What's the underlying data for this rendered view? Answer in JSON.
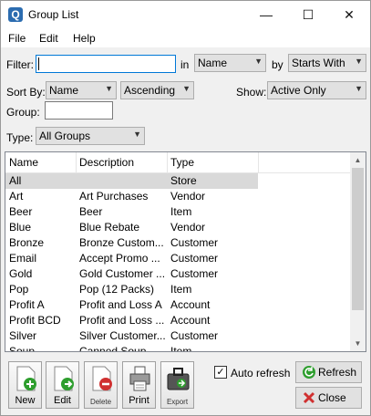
{
  "window": {
    "title": "Group List",
    "app_icon": "Q"
  },
  "menu": [
    "File",
    "Edit",
    "Help"
  ],
  "filter": {
    "label": "Filter:",
    "value": "",
    "in_label": "in",
    "in_value": "Name",
    "by_label": "by",
    "by_value": "Starts With"
  },
  "sort": {
    "label": "Sort By:",
    "field": "Name",
    "order": "Ascending"
  },
  "show": {
    "label": "Show:",
    "value": "Active Only"
  },
  "group": {
    "label": "Group:",
    "value": ""
  },
  "type": {
    "label": "Type:",
    "value": "All Groups"
  },
  "list": {
    "columns": [
      "Name",
      "Description",
      "Type"
    ],
    "rows": [
      {
        "name": "All",
        "description": "",
        "type": "Store"
      },
      {
        "name": "Art",
        "description": "Art Purchases",
        "type": "Vendor"
      },
      {
        "name": "Beer",
        "description": "Beer",
        "type": "Item"
      },
      {
        "name": "Blue",
        "description": "Blue Rebate",
        "type": "Vendor"
      },
      {
        "name": "Bronze",
        "description": "Bronze Custom...",
        "type": "Customer"
      },
      {
        "name": "Email",
        "description": "Accept Promo ...",
        "type": "Customer"
      },
      {
        "name": "Gold",
        "description": "Gold Customer ...",
        "type": "Customer"
      },
      {
        "name": "Pop",
        "description": "Pop (12 Packs)",
        "type": "Item"
      },
      {
        "name": "Profit A",
        "description": "Profit and Loss A",
        "type": "Account"
      },
      {
        "name": "Profit BCD",
        "description": "Profit and Loss ...",
        "type": "Account"
      },
      {
        "name": "Silver",
        "description": "Silver Customer...",
        "type": "Customer"
      },
      {
        "name": "Soup",
        "description": "Canned Soup",
        "type": "Item"
      }
    ]
  },
  "toolbar": {
    "new": "New",
    "edit": "Edit",
    "delete": "Delete",
    "print": "Print",
    "export": "Export"
  },
  "auto_refresh": {
    "label": "Auto refresh",
    "checked": true,
    "mark": "✓"
  },
  "refresh_button": "Refresh",
  "close_button": "Close",
  "colors": {
    "accent": "#0078d7",
    "selected_row": "#d9d9d9",
    "new_icon": "#2e9e2e",
    "delete_icon": "#d03030"
  }
}
